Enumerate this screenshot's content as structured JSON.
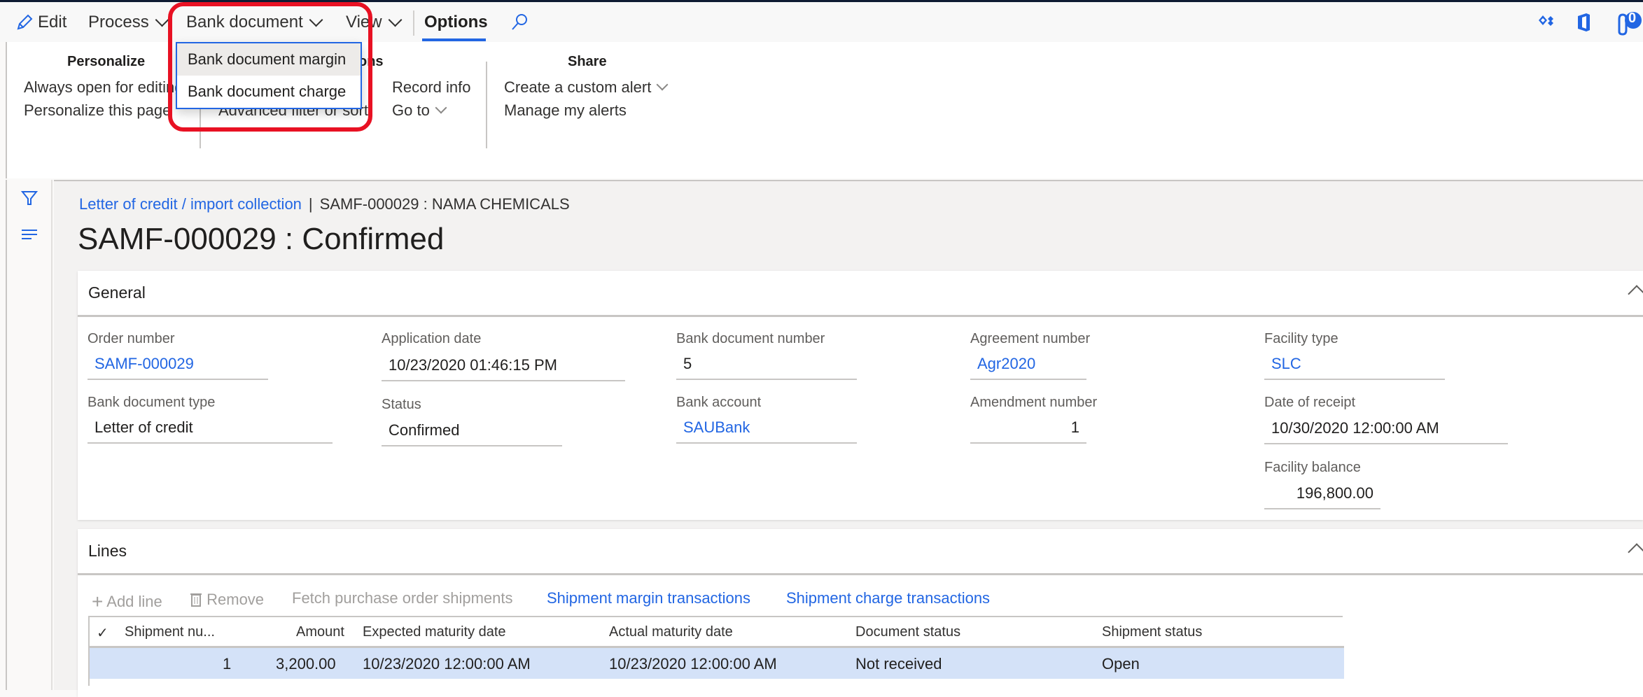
{
  "actionbar": {
    "edit_label": "Edit",
    "process_label": "Process",
    "bank_document_label": "Bank document",
    "view_label": "View",
    "options_label": "Options",
    "notification_count": "0"
  },
  "dropdown": {
    "items": [
      {
        "label": "Bank document margin"
      },
      {
        "label": "Bank document charge"
      }
    ]
  },
  "ribbon": {
    "personalize": {
      "heading": "Personalize",
      "items": [
        "Always open for editing",
        "Personalize this page"
      ]
    },
    "page_options": {
      "heading_visible": "ons",
      "items": [
        "Advanced filter or sort"
      ]
    },
    "record": {
      "items": [
        "Record info",
        "Go to"
      ]
    },
    "share": {
      "heading": "Share",
      "items": [
        "Create a custom alert",
        "Manage my alerts"
      ]
    }
  },
  "breadcrumb": {
    "link": "Letter of credit / import collection",
    "separator": "|",
    "current": "SAMF-000029 : NAMA CHEMICALS"
  },
  "page_title": "SAMF-000029 : Confirmed",
  "general": {
    "title": "General",
    "fields": {
      "order_number": {
        "label": "Order number",
        "value": "SAMF-000029"
      },
      "application_date": {
        "label": "Application date",
        "value": "10/23/2020 01:46:15 PM"
      },
      "bank_document_number": {
        "label": "Bank document number",
        "value": "5"
      },
      "agreement_number": {
        "label": "Agreement number",
        "value": "Agr2020"
      },
      "facility_type": {
        "label": "Facility type",
        "value": "SLC"
      },
      "bank_document_type": {
        "label": "Bank document type",
        "value": "Letter of credit"
      },
      "status": {
        "label": "Status",
        "value": "Confirmed"
      },
      "bank_account": {
        "label": "Bank account",
        "value": "SAUBank"
      },
      "amendment_number": {
        "label": "Amendment number",
        "value": "1"
      },
      "date_of_receipt": {
        "label": "Date of receipt",
        "value": "10/30/2020 12:00:00 AM"
      },
      "facility_balance": {
        "label": "Facility balance",
        "value": "196,800.00"
      }
    }
  },
  "lines": {
    "title": "Lines",
    "toolbar": {
      "add_line": "Add line",
      "remove": "Remove",
      "fetch": "Fetch purchase order shipments",
      "margin_tx": "Shipment margin transactions",
      "charge_tx": "Shipment charge transactions"
    },
    "columns": [
      "Shipment nu...",
      "Amount",
      "Expected maturity date",
      "Actual maturity date",
      "Document status",
      "Shipment status"
    ],
    "rows": [
      {
        "shipment_number": "1",
        "amount": "3,200.00",
        "expected": "10/23/2020 12:00:00 AM",
        "actual": "10/23/2020 12:00:00 AM",
        "document_status": "Not received",
        "shipment_status": "Open"
      }
    ]
  }
}
